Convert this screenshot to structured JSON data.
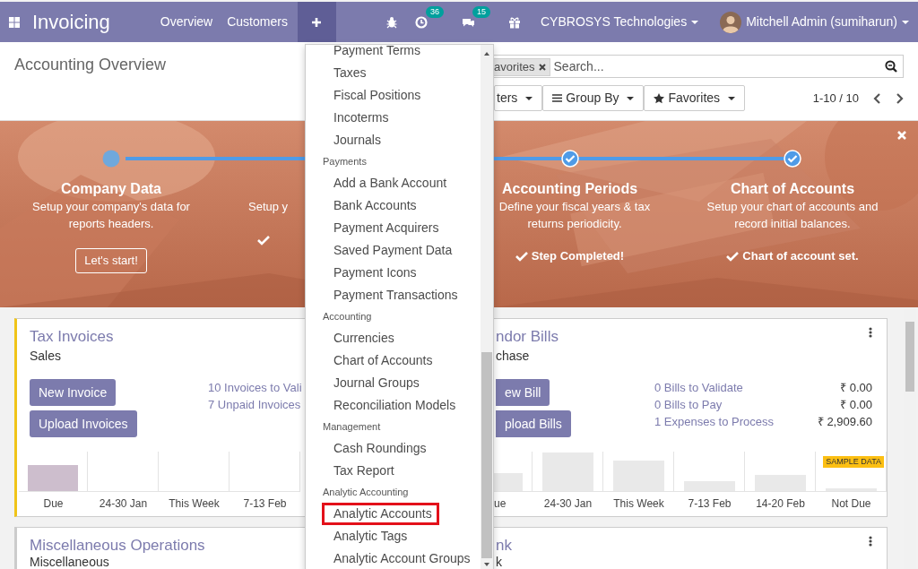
{
  "navbar": {
    "app_name": "Invoicing",
    "menu": [
      {
        "label": "Overview"
      },
      {
        "label": "Customers"
      }
    ],
    "quick_create": {
      "expanded": true
    },
    "activity_badge": "36",
    "messages_badge": "15",
    "company": "CYBROSYS Technologies",
    "user": "Mitchell Admin (sumiharun)"
  },
  "control_panel": {
    "breadcrumb": "Accounting Overview",
    "search": {
      "facet": "avorites",
      "placeholder": "Search..."
    },
    "buttons": [
      {
        "label": "ters",
        "kind": "filter"
      },
      {
        "label": "Group By",
        "kind": "groupby"
      },
      {
        "label": "Favorites",
        "kind": "favorites"
      }
    ],
    "pager": "1-10 / 10"
  },
  "banner": {
    "steps": [
      {
        "kind": "full",
        "title": "Company Data",
        "description": "Setup your company's data for reports headers.",
        "done": false,
        "action": "Let's start!"
      },
      {
        "kind": "cut",
        "description": "Setup y",
        "done": true
      },
      {
        "kind": "full",
        "title": "Accounting Periods",
        "description": "Define your fiscal years & tax returns periodicity.",
        "done": true,
        "status": "Step Completed!"
      },
      {
        "kind": "full",
        "title": "Chart of Accounts",
        "description": "Setup your chart of accounts and record initial balances.",
        "done": true,
        "status": "Chart of account set."
      }
    ]
  },
  "dashboard": {
    "rows": [
      {
        "left": {
          "title": "Tax Invoices",
          "subtitle": "Sales",
          "color": "#f0c419",
          "buttons": [
            "New Invoice",
            "Upload Invoices"
          ],
          "links": [
            {
              "label": "10 Invoices to Vali"
            },
            {
              "label": "7 Unpaid Invoices"
            }
          ],
          "chart_labels": [
            "Due",
            "24-30 Jan",
            "This Week",
            "7-13 Feb"
          ]
        },
        "right": {
          "title": "ndor Bills",
          "subtitle": "chase",
          "menu": true,
          "buttons": [
            "ew Bill",
            "pload Bills"
          ],
          "links": [
            {
              "label": "0 Bills to Validate",
              "amount": "₹ 0.00"
            },
            {
              "label": "0 Bills to Pay",
              "amount": "₹ 0.00"
            },
            {
              "label": "1 Expenses to Process",
              "amount": "₹ 2,909.60"
            }
          ],
          "chart_labels": [
            "ue",
            "24-30 Jan",
            "This Week",
            "7-13 Feb",
            "14-20 Feb",
            "Not Due"
          ],
          "sample_badge": "SAMPLE DATA"
        }
      },
      {
        "left": {
          "title": "Miscellaneous Operations",
          "subtitle": "Miscellaneous"
        },
        "right": {
          "title": "nk",
          "subtitle": "k",
          "menu": true
        }
      }
    ]
  },
  "dropdown": {
    "items": [
      {
        "kind": "item",
        "label": "Payment Terms",
        "highlighted": false
      },
      {
        "kind": "item",
        "label": "Taxes",
        "highlighted": false
      },
      {
        "kind": "item",
        "label": "Fiscal Positions",
        "highlighted": false
      },
      {
        "kind": "item",
        "label": "Incoterms",
        "highlighted": false
      },
      {
        "kind": "item",
        "label": "Journals",
        "highlighted": false
      },
      {
        "kind": "header",
        "label": "Payments"
      },
      {
        "kind": "item",
        "label": "Add a Bank Account",
        "highlighted": false
      },
      {
        "kind": "item",
        "label": "Bank Accounts",
        "highlighted": false
      },
      {
        "kind": "item",
        "label": "Payment Acquirers",
        "highlighted": false
      },
      {
        "kind": "item",
        "label": "Saved Payment Data",
        "highlighted": false
      },
      {
        "kind": "item",
        "label": "Payment Icons",
        "highlighted": false
      },
      {
        "kind": "item",
        "label": "Payment Transactions",
        "highlighted": false
      },
      {
        "kind": "header",
        "label": "Accounting"
      },
      {
        "kind": "item",
        "label": "Currencies",
        "highlighted": false
      },
      {
        "kind": "item",
        "label": "Chart of Accounts",
        "highlighted": false
      },
      {
        "kind": "item",
        "label": "Journal Groups",
        "highlighted": false
      },
      {
        "kind": "item",
        "label": "Reconciliation Models",
        "highlighted": false
      },
      {
        "kind": "header",
        "label": "Management"
      },
      {
        "kind": "item",
        "label": "Cash Roundings",
        "highlighted": false
      },
      {
        "kind": "item",
        "label": "Tax Report",
        "highlighted": false
      },
      {
        "kind": "header",
        "label": "Analytic Accounting"
      },
      {
        "kind": "item",
        "label": "Analytic Accounts",
        "highlighted": true
      },
      {
        "kind": "item",
        "label": "Analytic Tags",
        "highlighted": false
      },
      {
        "kind": "item",
        "label": "Analytic Account Groups",
        "highlighted": false
      }
    ]
  }
}
